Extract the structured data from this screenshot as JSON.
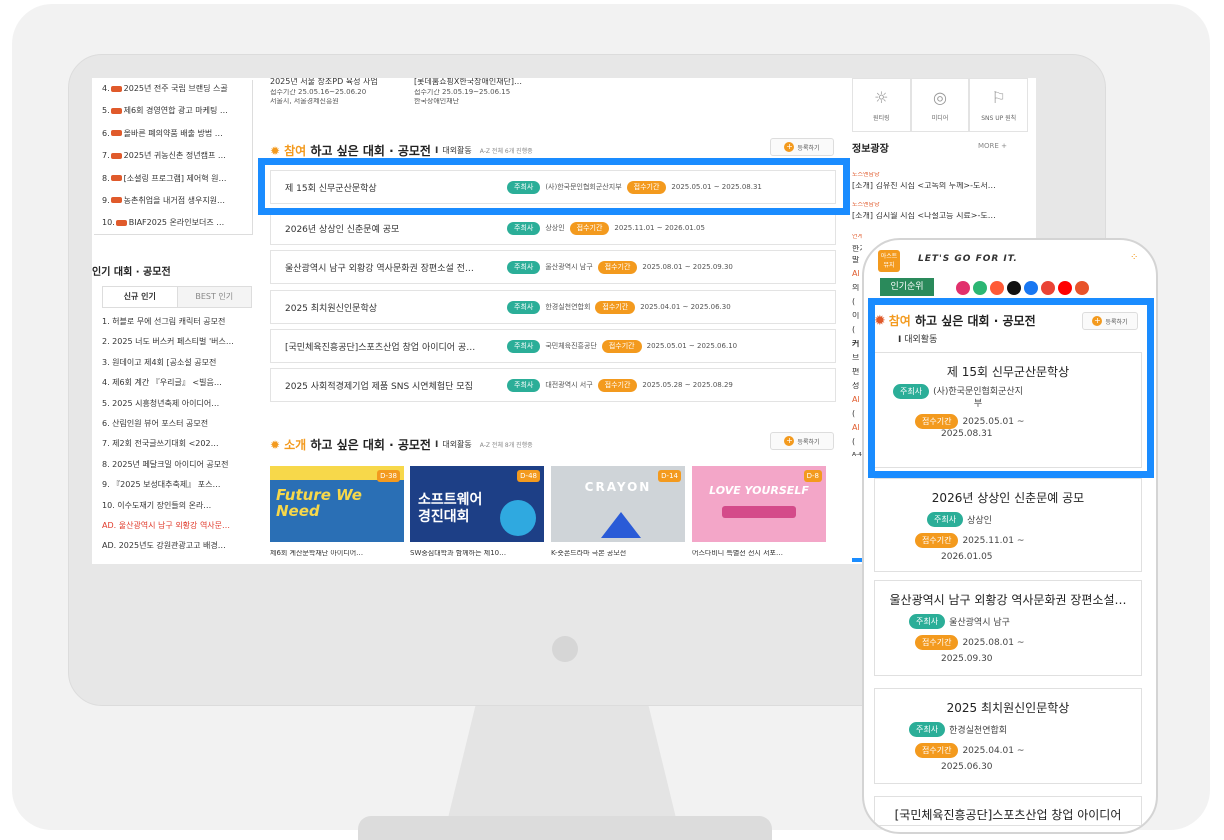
{
  "left_top_list": [
    {
      "num": "4.",
      "text": "2025년 전주 국립 브랜딩 스골"
    },
    {
      "num": "5.",
      "text": "제6회 경영연합 광고 마케팅 …"
    },
    {
      "num": "6.",
      "text": "올바른 폐의약품 배출 방법 …"
    },
    {
      "num": "7.",
      "text": "2025년 귀농신촌 정년캠프 …"
    },
    {
      "num": "8.",
      "text": "[소셜링 프로그램] 제어혁 원…"
    },
    {
      "num": "9.",
      "text": "농촌취업을 내거점 생우지원…"
    },
    {
      "num": "10.",
      "text": "BIAF2025 온라인보더즈 …"
    }
  ],
  "popular": {
    "title": "인기 대회 · 공모전",
    "tabs": [
      "신규 인기",
      "BEST 인기"
    ],
    "items": [
      "1. 허블로 무에 선그림 캐릭터 공모전",
      "2. 2025 너도 버스커 페스티벌 '버스…",
      "3. 원데이고 제4회 [공소설 공모전",
      "4. 제6회 계간 『우리글』 <빌음…",
      "5. 2025 시흥청년축제 아이디어…",
      "6. 산림인원 뷰어 포스터 공모전",
      "7. 제2회 전국글쓰기대회 <202…",
      "8. 2025년 페달크밀 아이디어 공모전",
      "9. 『2025 보성대추축제』 포스…",
      "10. 이수도재기 장인들의 온라…",
      "AD. 울산광역시 남구 외황강 역사문…",
      "AD. 2025년도 강원관광고고 배경…"
    ]
  },
  "top_partial": [
    {
      "title": "2025년 서울 창조PD 육성 사업",
      "host": "서울시, 서울경제진흥원",
      "date": "접수기간 25.05.16~25.06.20"
    },
    {
      "title": "[롯데홈쇼핑X한국장애인재단]…",
      "host": "한국장애인재단",
      "date": "접수기간 25.05.19~25.06.15"
    }
  ],
  "participate": {
    "title_hl": "참여",
    "title_rest": " 하고 싶은 대회 · 공모전",
    "sep": "I",
    "category": "대외활동",
    "meta": "A-Z 전체 6개 진행중",
    "reg_btn": "등록하기",
    "host_badge": "주최사",
    "period_badge": "접수기간",
    "rows": [
      {
        "title": "제 15회 신무군산문학상",
        "host": "(사)한국문인협회군산지부",
        "date": "2025.05.01 ~ 2025.08.31"
      },
      {
        "title": "2026년 상상인 신춘문예 공모",
        "host": "상상인",
        "date": "2025.11.01 ~ 2026.01.05"
      },
      {
        "title": "울산광역시 남구 외황강 역사문화권 장편소설 전…",
        "host": "울산광역시 남구",
        "date": "2025.08.01 ~ 2025.09.30"
      },
      {
        "title": "2025 최치원신인문학상",
        "host": "한경실천연합회",
        "date": "2025.04.01 ~ 2025.06.30"
      },
      {
        "title": "[국민체육진흥공단]스포츠산업 창업 아이디어 공…",
        "host": "국민체육진흥공단",
        "date": "2025.05.01 ~ 2025.06.10"
      },
      {
        "title": "2025 사회적경제기업 제품 SNS 시연체험단 모집",
        "host": "대전광역시 서구",
        "date": "2025.05.28 ~ 2025.08.29"
      }
    ]
  },
  "introduce": {
    "title_hl": "소개",
    "title_rest": " 하고 싶은 대회 · 공모전",
    "sep": "I",
    "category": "대외활동",
    "meta": "A-Z 전체 8개 진행중",
    "reg_btn": "등록하기",
    "thumbs": [
      {
        "caption": "제6회 계산문학재단 아이디어…",
        "text": "Future We Need",
        "dday": "D-38"
      },
      {
        "caption": "SW중심대학과 함께하는 제10…",
        "text": "소프트웨어 경진대회",
        "dday": "D-48"
      },
      {
        "caption": "K-숏폰드라마 극본 공모전",
        "text": "CRAYON",
        "dday": "D-14"
      },
      {
        "caption": "어스다비니 특별전 전시 서포…",
        "text": "LOVE YOURSELF",
        "dday": "D-8"
      }
    ]
  },
  "right_panel": {
    "icons": [
      {
        "label": "원티링"
      },
      {
        "label": "미디어"
      },
      {
        "label": "SNS UP 원칙"
      }
    ],
    "info_title": "정보광장",
    "more": "MORE",
    "items": [
      {
        "tag": "도스엔담당",
        "text": "[소개] 김유진 시집 <고독의 두께>-도서…"
      },
      {
        "tag": "도스엔담당",
        "text": "[소개] 김시월 시집 <나절고등 시료>-도…"
      }
    ],
    "fragments": [
      "연계한국어",
      "한가",
      "발",
      "Al",
      "의",
      "(",
      "이",
      "(",
      "커",
      "브",
      "편",
      "성",
      "Al",
      "(",
      "Al",
      "(",
      "A-4"
    ]
  },
  "phone": {
    "logo_line1": "아스트",
    "logo_line2": "뮤지",
    "slogan": "LET'S GO FOR IT.",
    "rank_btn": "인기순위",
    "social_colors": [
      "#e1306c",
      "#2bb673",
      "#ff5a36",
      "#111111",
      "#1877f2",
      "#ea4335",
      "#ff0000",
      "#e8532a"
    ],
    "section": {
      "title_hl": "참여",
      "title_rest": " 하고 싶은 대회 · 공모전",
      "sep": "I",
      "category": "대외활동",
      "reg_btn": "등록하기"
    },
    "host_badge": "주최사",
    "period_badge": "접수기간",
    "cards": [
      {
        "title": "제 15회 신무군산문학상",
        "host_line1": "(사)한국문인협회군산지",
        "host_line2": "부",
        "date_line1": "2025.05.01 ~",
        "date_line2": "2025.08.31"
      },
      {
        "title": "2026년 상상인 신춘문예 공모",
        "host_line1": "상상인",
        "host_line2": "",
        "date_line1": "2025.11.01 ~",
        "date_line2": "2026.01.05"
      },
      {
        "title": "울산광역시 남구 외황강 역사문화권 장편소설…",
        "host_line1": "울산광역시 남구",
        "host_line2": "",
        "date_line1": "2025.08.01 ~",
        "date_line2": "2025.09.30"
      },
      {
        "title": "2025 최치원신인문학상",
        "host_line1": "한경실천연합회",
        "host_line2": "",
        "date_line1": "2025.04.01 ~",
        "date_line2": "2025.06.30"
      }
    ],
    "last_partial": "[국민체육진흥공단]스포츠산업 창업 아이디어"
  },
  "colors": {
    "accent": "#f39a1e",
    "teal": "#2bae98",
    "highlight": "#1a8cff"
  }
}
